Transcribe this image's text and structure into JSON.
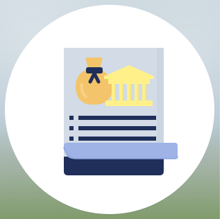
{
  "scene": {
    "icon": "document-with-money-bag-and-bank-icon",
    "colors": {
      "paper": "#d2dbe6",
      "paper_shadow": "#bccbd9",
      "scroll_back": "#1f2f5a",
      "scroll_curl": "#9fb3e6",
      "lines": "#1f2f5a",
      "money_bag": "#f4c46a",
      "bank": "#fff08a",
      "accent_navy": "#1f2f5a"
    }
  }
}
